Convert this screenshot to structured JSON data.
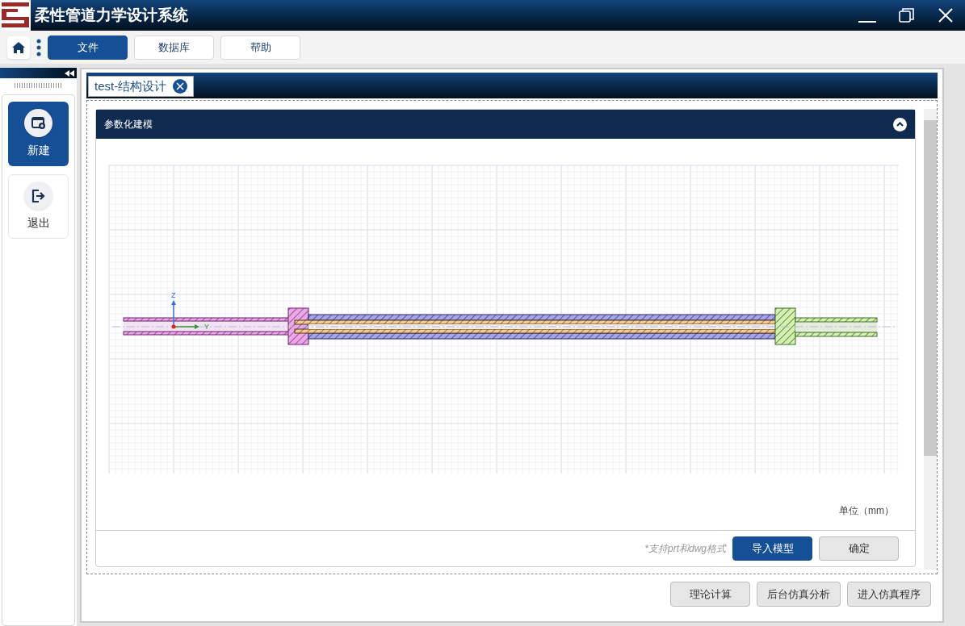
{
  "window": {
    "title": "柔性管道力学设计系统"
  },
  "menu": [
    {
      "label": "文件",
      "selected": true
    },
    {
      "label": "数据库",
      "selected": false
    },
    {
      "label": "帮助",
      "selected": false
    }
  ],
  "sidebar": {
    "items": [
      {
        "label": "新建",
        "kind": "new",
        "selected": true
      },
      {
        "label": "退出",
        "kind": "exit",
        "selected": false
      }
    ]
  },
  "document_tab": {
    "title": "test-结构设计"
  },
  "panel": {
    "title": "参数化建模",
    "expanded": true,
    "axis_labels": {
      "vertical": "Z",
      "horizontal": "Y"
    },
    "unit": "单位（mm）",
    "hint": "*支持prt和dwg格式",
    "buttons": [
      {
        "label": "导入模型",
        "kind": "primary"
      },
      {
        "label": "确定",
        "kind": "secondary"
      }
    ]
  },
  "footer_buttons": [
    "理论计算",
    "后台仿真分析",
    "进入仿真程序"
  ]
}
